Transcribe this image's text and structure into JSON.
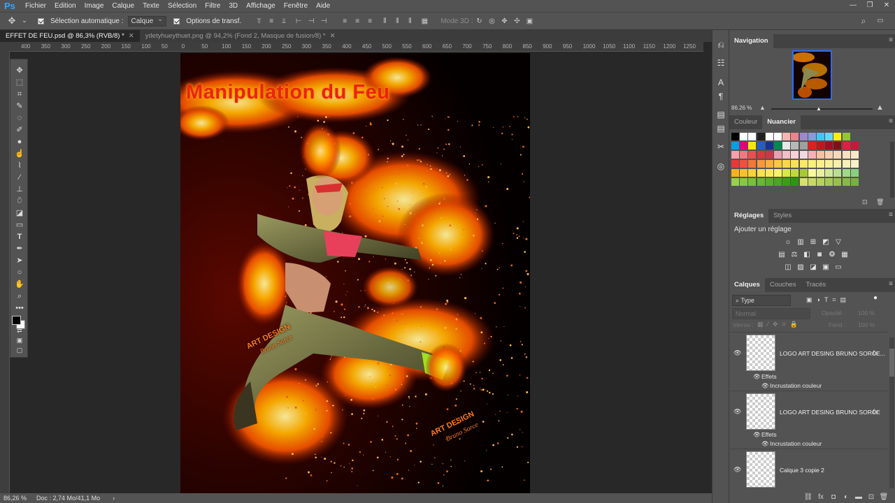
{
  "app": {
    "logo": "Ps"
  },
  "menubar": {
    "items": [
      "Fichier",
      "Edition",
      "Image",
      "Calque",
      "Texte",
      "Sélection",
      "Filtre",
      "3D",
      "Affichage",
      "Fenêtre",
      "Aide"
    ]
  },
  "options": {
    "auto_select_label": "Sélection automatique :",
    "auto_select_value": "Calque",
    "transform_label": "Options de transf.",
    "mode3d_label": "Mode 3D :"
  },
  "tabs": [
    {
      "label": "EFFET DE FEU.psd @ 86,3% (RVB/8) *",
      "active": true
    },
    {
      "label": "ydetyhueythuet.png @ 94,2% (Fond 2, Masque de fusion/8) *",
      "active": false
    }
  ],
  "ruler": {
    "h": [
      "400",
      "350",
      "300",
      "250",
      "200",
      "150",
      "100",
      "50",
      "0",
      "50",
      "100",
      "150",
      "200",
      "250",
      "300",
      "350",
      "400",
      "450",
      "500",
      "550",
      "600",
      "650",
      "700",
      "750",
      "800",
      "850",
      "900",
      "950",
      "1000",
      "1050",
      "1100",
      "1150",
      "1200",
      "1250"
    ]
  },
  "poster": {
    "title": "Manipulation du Feu",
    "sig_top": "ART DESIGN",
    "sig_sub": "Bruno Sorce"
  },
  "status": {
    "zoom": "86,26 %",
    "doc": "Doc : 2,74 Mo/41,1 Mo"
  },
  "navigation": {
    "title": "Navigation",
    "zoom": "86.26 %"
  },
  "color_panel": {
    "tabs": [
      "Couleur",
      "Nuancier"
    ],
    "active": "Nuancier"
  },
  "swatch_rows": [
    [
      "#000000",
      "#ffffff",
      "#ffffff",
      "#202020",
      "#ffffff",
      "#ffffff",
      "#f4b6b0",
      "#e8848a",
      "#9e8ac8",
      "#8a9ad8",
      "#3ec8f0",
      "#60d8f8",
      "#f8f000",
      "#90c830"
    ],
    [
      "#00a0e8",
      "#e0007a",
      "#f8e800",
      "#2060c0",
      "#1a3090",
      "#008850",
      "#e8e8e8",
      "#b8b8b8",
      "#a0a0a0",
      "#e02020",
      "#c01818",
      "#a01020",
      "#801018",
      "#e02040",
      "#c81838"
    ],
    [
      "#f8a0a8",
      "#f07880",
      "#e85050",
      "#d83838",
      "#c83848",
      "#e8a0b0",
      "#f0c0c8",
      "#f8d0d8",
      "#f0d8e0",
      "#f8b0b8",
      "#f8c0a0",
      "#f8d0b0",
      "#f8d8b8",
      "#f8e0c0",
      "#f8e8c8"
    ],
    [
      "#e83838",
      "#f05040",
      "#f07838",
      "#f89838",
      "#f8b038",
      "#f8c840",
      "#f8d848",
      "#f8e058",
      "#f8e868",
      "#f8f078",
      "#f8f088",
      "#f8f098",
      "#f8f0a8",
      "#f8f0b8",
      "#f8f0c8"
    ],
    [
      "#f8b020",
      "#f8c030",
      "#f8d040",
      "#f8e050",
      "#f8e860",
      "#f8f070",
      "#d8e848",
      "#c0d840",
      "#a8c838",
      "#f8f8a0",
      "#e8f0a0",
      "#d0e898",
      "#b8e090",
      "#a0d888",
      "#88d080"
    ],
    [
      "#98d048",
      "#88c840",
      "#78c038",
      "#68b830",
      "#58b028",
      "#48a820",
      "#38a018",
      "#289810",
      "#d8e070",
      "#c8d868",
      "#b8d060",
      "#a8c858",
      "#98c050",
      "#88b848",
      "#78b040"
    ]
  ],
  "adjustments": {
    "tabs": [
      "Réglages",
      "Styles"
    ],
    "title": "Ajouter un réglage"
  },
  "layers_panel": {
    "tabs": [
      "Calques",
      "Couches",
      "Tracés"
    ],
    "filter": "Type",
    "blend_mode": "Normal",
    "opacity_label": "Opacité :",
    "opacity_value": "100 %",
    "lock_label": "Verrou :",
    "fill_label": "Fond :",
    "fill_value": "100 %",
    "layers": [
      {
        "name": "LOGO ART DESING BRUNO SORCE...",
        "fx": "fx",
        "effects": "Effets",
        "effect": "Incrustation couleur"
      },
      {
        "name": "LOGO ART DESING BRUNO SORCE",
        "fx": "fx",
        "effects": "Effets",
        "effect": "Incrustation couleur"
      },
      {
        "name": "Calque 3 copie 2",
        "fx": "",
        "effects": "",
        "effect": ""
      }
    ]
  },
  "colors": {
    "accent": "#31a8ff",
    "chrome": "#535353",
    "canvas_bg": "#282828",
    "fire": "#ff7a1a"
  }
}
